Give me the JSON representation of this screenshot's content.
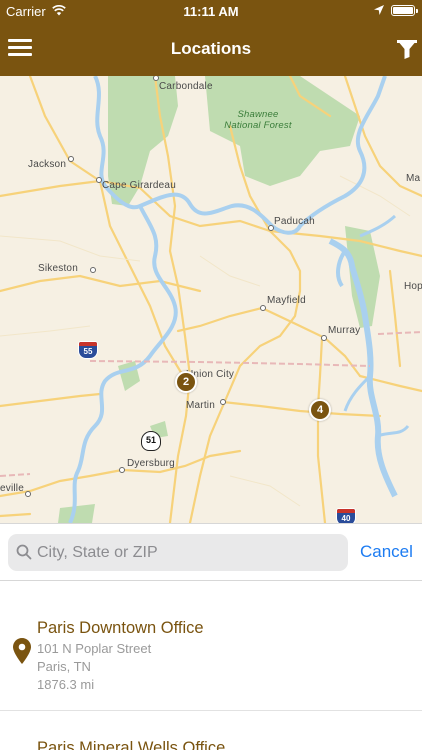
{
  "status_bar": {
    "carrier": "Carrier",
    "time": "11:11 AM"
  },
  "navbar": {
    "title": "Locations",
    "menu_icon": "hamburger-menu-icon",
    "filter_icon": "funnel-filter-icon"
  },
  "map": {
    "labels": {
      "carbondale": "Carbondale",
      "shawnee": "Shawnee\nNational Forest",
      "jackson": "Jackson",
      "cape_girardeau": "Cape Girardeau",
      "paducah": "Paducah",
      "sikeston": "Sikeston",
      "mayfield": "Mayfield",
      "murray": "Murray",
      "union_city": "Union City",
      "martin": "Martin",
      "dyersburg": "Dyersburg",
      "ma": "Ma",
      "hop": "Hop",
      "eville": "eville"
    },
    "clusters": [
      {
        "count": "2"
      },
      {
        "count": "4"
      }
    ],
    "shields": {
      "i55": "55",
      "us51": "51",
      "i40": "40"
    },
    "colors": {
      "land": "#f6f0e3",
      "park": "#bfdcb0",
      "water": "#a9d0ef",
      "road": "#f7d27a"
    }
  },
  "search": {
    "placeholder": "City, State or ZIP",
    "value": "",
    "cancel_label": "Cancel"
  },
  "locations": [
    {
      "name": "Paris Downtown Office",
      "address": "101 N Poplar Street",
      "city": "Paris, TN",
      "distance": "1876.3 mi"
    },
    {
      "name": "Paris Mineral Wells Office"
    }
  ],
  "theme": {
    "accent": "#7a5410",
    "link": "#1d7cf2"
  }
}
